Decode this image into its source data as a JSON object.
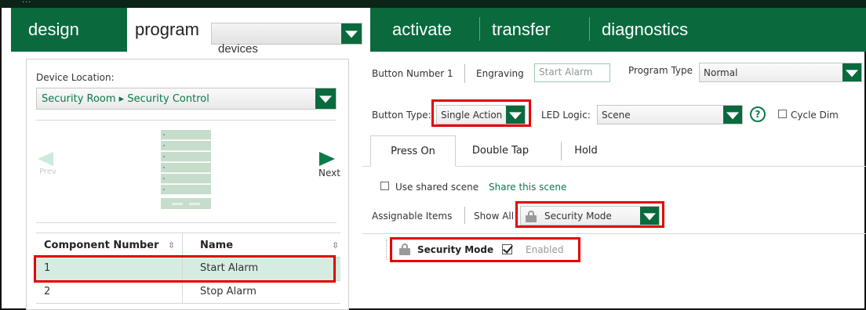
{
  "nav": {
    "tabs": [
      "design",
      "program",
      "activate",
      "transfer",
      "diagnostics"
    ],
    "device_select": "devices"
  },
  "left": {
    "device_location_label": "Device Location:",
    "location_value": "Security Room ▸ Security Control",
    "prev_label": "Prev",
    "next_label": "Next",
    "table": {
      "headers": [
        "Component Number",
        "Name"
      ],
      "rows": [
        {
          "number": "1",
          "name": "Start Alarm",
          "selected": true
        },
        {
          "number": "2",
          "name": "Stop Alarm",
          "selected": false
        }
      ]
    }
  },
  "right": {
    "button_number": "Button Number 1",
    "engraving_label": "Engraving",
    "engraving_value": "Start Alarm",
    "program_type_label": "Program Type",
    "program_type_value": "Normal",
    "button_type_label": "Button Type:",
    "button_type_value": "Single Action",
    "led_logic_label": "LED Logic:",
    "led_logic_value": "Scene",
    "help_glyph": "?",
    "cycle_dim_label": "Cycle Dim",
    "subtabs": [
      "Press On",
      "Double Tap",
      "Hold"
    ],
    "use_shared_scene_label": "Use shared scene",
    "share_link": "Share this scene",
    "assignable_items_label": "Assignable Items",
    "show_all_label": "Show All",
    "filter_value": "Security Mode",
    "item": {
      "name": "Security Mode",
      "status": "Enabled",
      "checked": true
    }
  },
  "colors": {
    "accent": "#0a6a3e",
    "highlight": "#e40000",
    "selected_row": "#d5ece2",
    "link": "#0a7a48"
  }
}
